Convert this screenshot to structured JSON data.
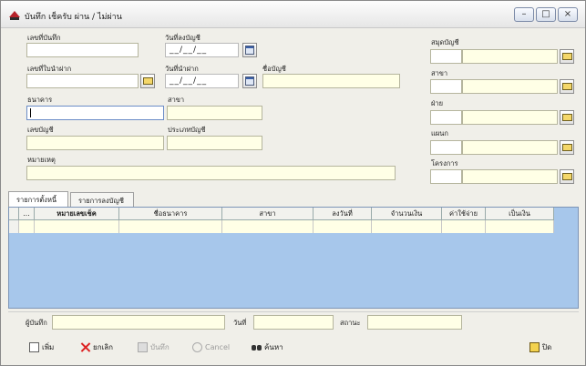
{
  "window": {
    "title": "บันทึก เช็ครับ ผ่าน / ไม่ผ่าน",
    "minimize": "–",
    "maximize": "□",
    "close": "×"
  },
  "form": {
    "record_no_label": "เลขที่บันทึก",
    "record_date_label": "วันที่ลงบัญชี",
    "record_date_value": "__/__/__",
    "deposit_slip_label": "เลขที่ใบนำฝาก",
    "deposit_date_label": "วันที่นำฝาก",
    "deposit_date_value": "__/__/__",
    "account_name_label": "ชื่อบัญชี",
    "bank_label": "ธนาคาร",
    "branch_label": "สาขา",
    "account_no_label": "เลขบัญชี",
    "account_type_label": "ประเภทบัญชี",
    "remark_label": "หมายเหตุ"
  },
  "side": {
    "ledger_label": "สมุดบัญชี",
    "branch_label": "สาขา",
    "division_label": "ฝ่าย",
    "department_label": "แผนก",
    "project_label": "โครงการ"
  },
  "tabs": [
    {
      "label": "รายการตั้งหนี้"
    },
    {
      "label": "รายการลงบัญชี"
    }
  ],
  "grid": {
    "columns": [
      "...",
      "หมายเลขเช็ค",
      "ชื่อธนาคาร",
      "สาขา",
      "ลงวันที่",
      "จำนวนเงิน",
      "ค่าใช้จ่าย",
      "เป็นเงิน"
    ]
  },
  "footer": {
    "recorder_label": "ผู้บันทึก",
    "date_label": "วันที่",
    "status_label": "สถานะ"
  },
  "toolbar": {
    "new": "เพิ่ม",
    "delete": "ยกเลิก",
    "save": "บันทึก",
    "cancel": "Cancel",
    "find": "ค้นหา",
    "close": "ปิด"
  }
}
